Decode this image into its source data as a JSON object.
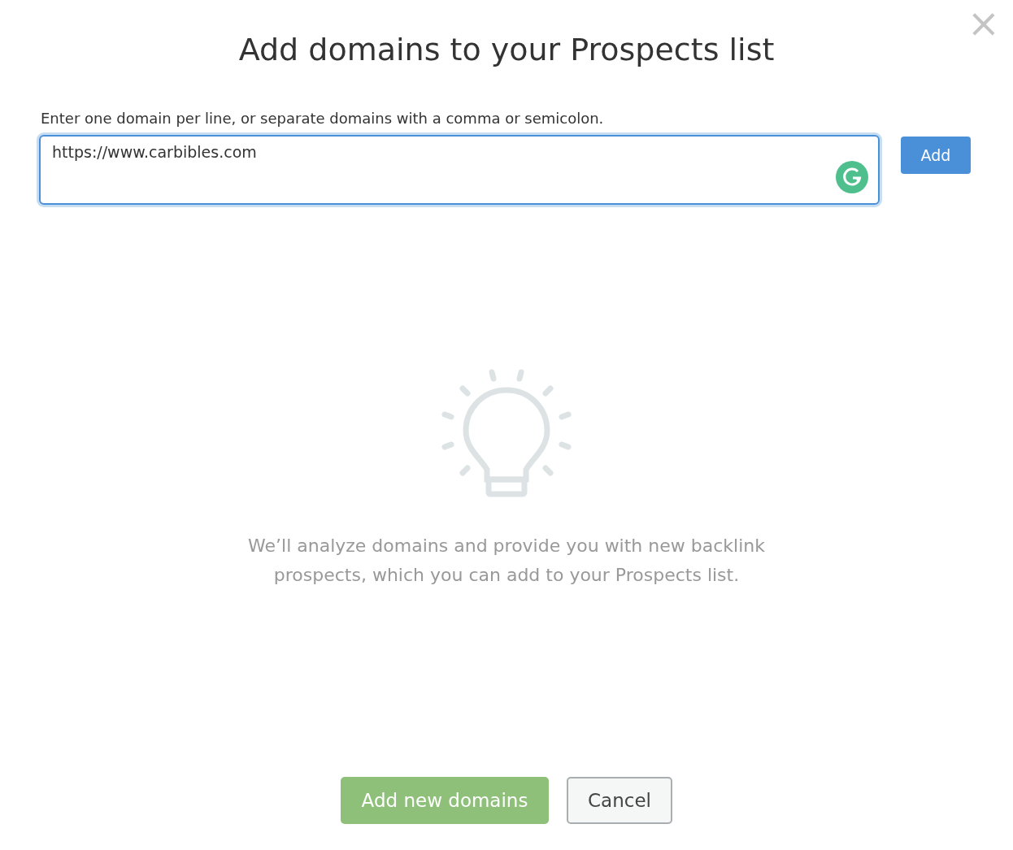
{
  "dialog": {
    "title": "Add domains to your Prospects list",
    "close_label": "×"
  },
  "instruction": "Enter one domain per line, or separate domains with a comma or semicolon.",
  "domain_input": {
    "value": "https://www.carbibles.com",
    "focused": true
  },
  "add_button": {
    "label": "Add",
    "disabled": false
  },
  "empty_state": {
    "message": "We’ll analyze domains and provide you with new backlink prospects, which you can add to your Prospects list."
  },
  "footer_buttons": [
    {
      "label": "Add new domains",
      "kind": "primary",
      "disabled": true
    },
    {
      "label": "Cancel",
      "kind": "secondary",
      "disabled": false
    }
  ]
}
